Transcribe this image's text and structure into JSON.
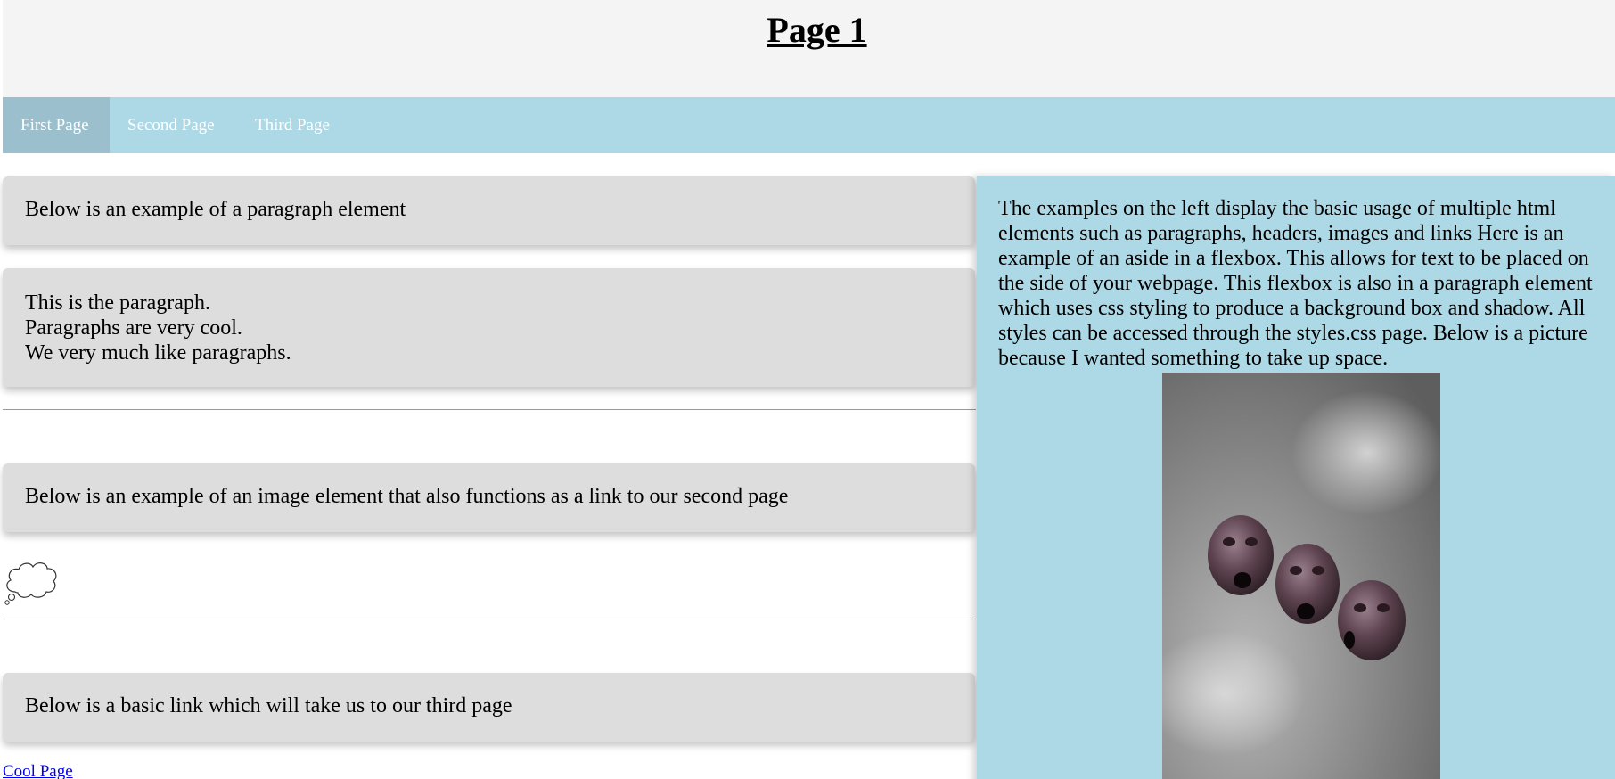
{
  "header": {
    "title": "Page 1"
  },
  "nav": {
    "items": [
      {
        "label": "First Page",
        "active": true
      },
      {
        "label": "Second Page",
        "active": false
      },
      {
        "label": "Third Page",
        "active": false
      }
    ]
  },
  "main": {
    "paragraph_intro": "Below is an example of a paragraph element",
    "paragraph_lines": [
      "This is the paragraph.",
      "Paragraphs are very cool.",
      "We very much like paragraphs."
    ],
    "image_intro": "Below is an example of an image element that also functions as a link to our second page",
    "image_link_icon": "thought-bubble-icon",
    "link_intro": "Below is a basic link which will take us to our third page",
    "link_text": "Cool Page"
  },
  "aside": {
    "text": "The examples on the left display the basic usage of multiple html elements such as paragraphs, headers, images and links Here is an example of an aside in a flexbox. This allows for text to be placed on the side of your webpage. This flexbox is also in a paragraph element which uses css styling to produce a background box and shadow. All styles can be accessed through the styles.css page. Below is a picture because I wanted something to take up space.",
    "image_subject": "three-masks-image"
  },
  "colors": {
    "header_bg": "#f4f4f4",
    "nav_bg": "#add8e6",
    "nav_active_bg": "#9bbfcc",
    "card_bg": "#dddddd",
    "link": "#0000ee"
  }
}
